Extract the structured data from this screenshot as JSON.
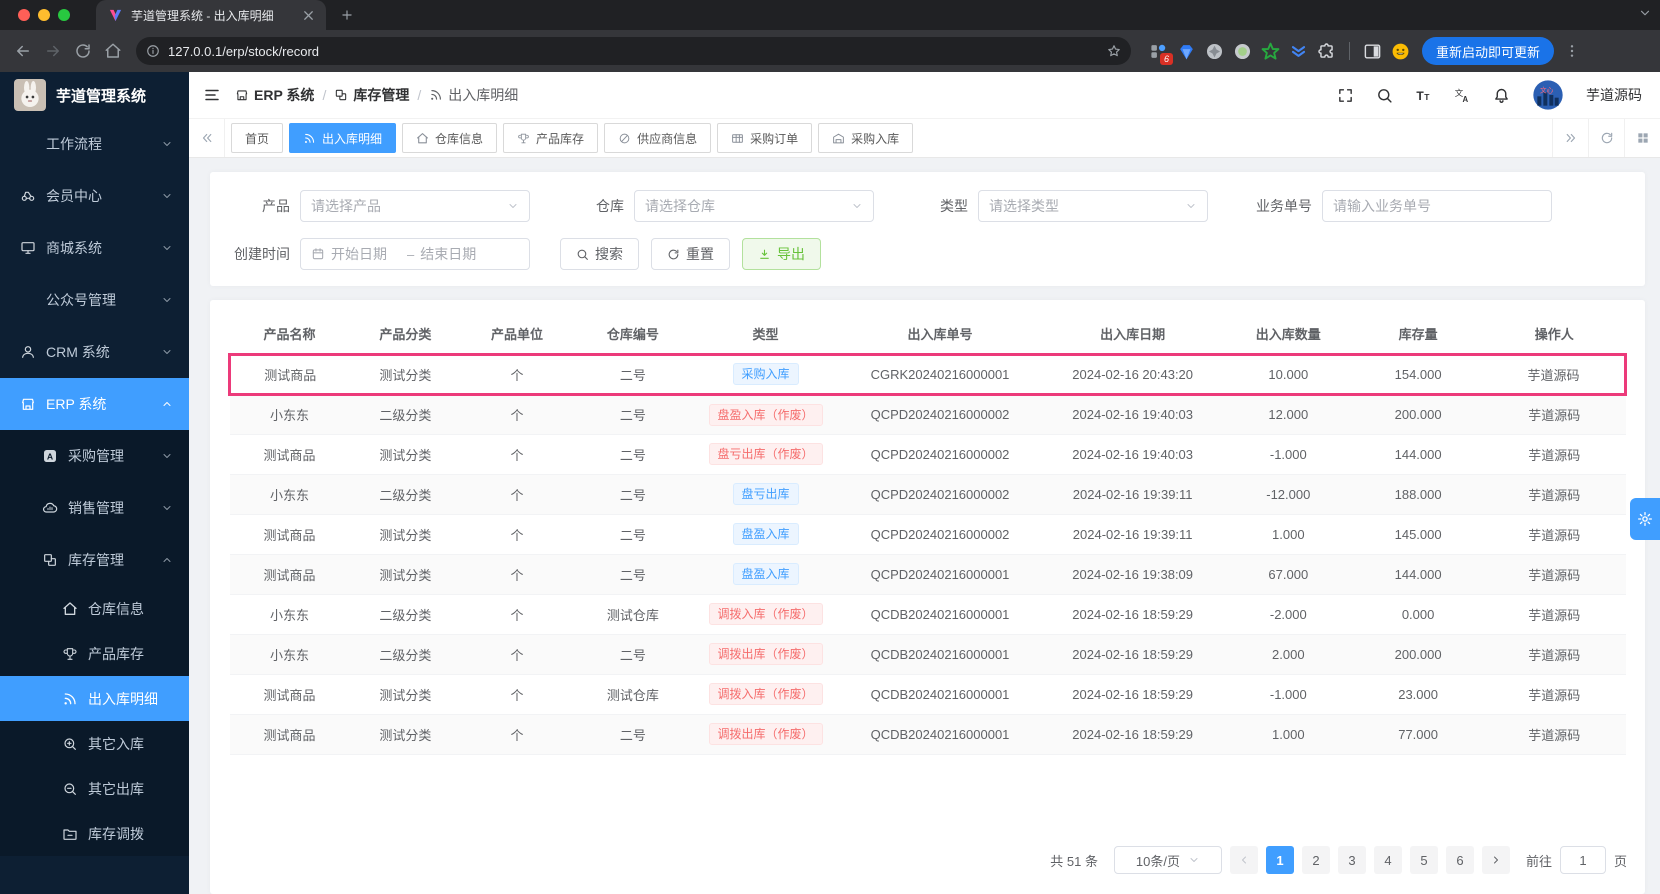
{
  "browser": {
    "tab_title": "芋道管理系统 - 出入库明细",
    "url": "127.0.0.1/erp/stock/record",
    "update_button": "重新启动即可更新",
    "extension_badge": "6"
  },
  "sidebar": {
    "app_title": "芋道管理系统",
    "menu": [
      {
        "label": "工作流程",
        "level": 1,
        "icon": null,
        "chevron": "down",
        "active": false
      },
      {
        "label": "会员中心",
        "level": 1,
        "icon": "member",
        "chevron": "down",
        "active": false
      },
      {
        "label": "商城系统",
        "level": 1,
        "icon": "monitor",
        "chevron": "down",
        "active": false
      },
      {
        "label": "公众号管理",
        "level": 1,
        "icon": null,
        "chevron": "down",
        "active": false
      },
      {
        "label": "CRM 系统",
        "level": 1,
        "icon": "person",
        "chevron": "down",
        "active": false
      },
      {
        "label": "ERP 系统",
        "level": 1,
        "icon": "store",
        "chevron": "up",
        "active": true
      },
      {
        "label": "采购管理",
        "level": 2,
        "icon": "a-square",
        "chevron": "down",
        "active": false
      },
      {
        "label": "销售管理",
        "level": 2,
        "icon": "cloud",
        "chevron": "down",
        "active": false
      },
      {
        "label": "库存管理",
        "level": 2,
        "icon": "boxes",
        "chevron": "up",
        "active": false
      },
      {
        "label": "仓库信息",
        "level": 3,
        "icon": "home",
        "chevron": null,
        "active": false
      },
      {
        "label": "产品库存",
        "level": 3,
        "icon": "cup",
        "chevron": null,
        "active": false
      },
      {
        "label": "出入库明细",
        "level": 3,
        "icon": "signal",
        "chevron": null,
        "active": true
      },
      {
        "label": "其它入库",
        "level": 3,
        "icon": "zoom-in",
        "chevron": null,
        "active": false
      },
      {
        "label": "其它出库",
        "level": 3,
        "icon": "zoom-out",
        "chevron": null,
        "active": false
      },
      {
        "label": "库存调拨",
        "level": 3,
        "icon": "folder",
        "chevron": null,
        "active": false
      }
    ]
  },
  "header": {
    "breadcrumb": [
      {
        "label": "ERP 系统",
        "icon": "store"
      },
      {
        "label": "库存管理",
        "icon": "boxes"
      },
      {
        "label": "出入库明细",
        "icon": "signal"
      }
    ],
    "username": "芋道源码"
  },
  "tabbar": {
    "tabs": [
      {
        "label": "首页",
        "icon": null,
        "active": false
      },
      {
        "label": "出入库明细",
        "icon": "signal",
        "active": true
      },
      {
        "label": "仓库信息",
        "icon": "home",
        "active": false
      },
      {
        "label": "产品库存",
        "icon": "cup",
        "active": false
      },
      {
        "label": "供应商信息",
        "icon": "slash-circle",
        "active": false
      },
      {
        "label": "采购订单",
        "icon": "table",
        "active": false
      },
      {
        "label": "采购入库",
        "icon": "factory",
        "active": false
      }
    ]
  },
  "filters": {
    "product_label": "产品",
    "product_placeholder": "请选择产品",
    "warehouse_label": "仓库",
    "warehouse_placeholder": "请选择仓库",
    "type_label": "类型",
    "type_placeholder": "请选择类型",
    "biz_no_label": "业务单号",
    "biz_no_placeholder": "请输入业务单号",
    "create_time_label": "创建时间",
    "date_start_placeholder": "开始日期",
    "date_separator": "–",
    "date_end_placeholder": "结束日期",
    "search_button": "搜索",
    "reset_button": "重置",
    "export_button": "导出"
  },
  "table": {
    "columns": [
      "产品名称",
      "产品分类",
      "产品单位",
      "仓库编号",
      "类型",
      "出入库单号",
      "出入库日期",
      "出入库数量",
      "库存量",
      "操作人"
    ],
    "rows": [
      {
        "product": "测试商品",
        "category": "测试分类",
        "unit": "个",
        "warehouse": "二号",
        "type": "采购入库",
        "type_color": "blue",
        "no": "CGRK20240216000001",
        "date": "2024-02-16 20:43:20",
        "qty": "10.000",
        "stock": "154.000",
        "operator": "芋道源码",
        "highlighted": true
      },
      {
        "product": "小东东",
        "category": "二级分类",
        "unit": "个",
        "warehouse": "二号",
        "type": "盘盈入库（作废）",
        "type_color": "red",
        "no": "QCPD20240216000002",
        "date": "2024-02-16 19:40:03",
        "qty": "12.000",
        "stock": "200.000",
        "operator": "芋道源码",
        "highlighted": false
      },
      {
        "product": "测试商品",
        "category": "测试分类",
        "unit": "个",
        "warehouse": "二号",
        "type": "盘亏出库（作废）",
        "type_color": "red",
        "no": "QCPD20240216000002",
        "date": "2024-02-16 19:40:03",
        "qty": "-1.000",
        "stock": "144.000",
        "operator": "芋道源码",
        "highlighted": false
      },
      {
        "product": "小东东",
        "category": "二级分类",
        "unit": "个",
        "warehouse": "二号",
        "type": "盘亏出库",
        "type_color": "blue",
        "no": "QCPD20240216000002",
        "date": "2024-02-16 19:39:11",
        "qty": "-12.000",
        "stock": "188.000",
        "operator": "芋道源码",
        "highlighted": false
      },
      {
        "product": "测试商品",
        "category": "测试分类",
        "unit": "个",
        "warehouse": "二号",
        "type": "盘盈入库",
        "type_color": "blue",
        "no": "QCPD20240216000002",
        "date": "2024-02-16 19:39:11",
        "qty": "1.000",
        "stock": "145.000",
        "operator": "芋道源码",
        "highlighted": false
      },
      {
        "product": "测试商品",
        "category": "测试分类",
        "unit": "个",
        "warehouse": "二号",
        "type": "盘盈入库",
        "type_color": "blue",
        "no": "QCPD20240216000001",
        "date": "2024-02-16 19:38:09",
        "qty": "67.000",
        "stock": "144.000",
        "operator": "芋道源码",
        "highlighted": false
      },
      {
        "product": "小东东",
        "category": "二级分类",
        "unit": "个",
        "warehouse": "测试仓库",
        "type": "调拨入库（作废）",
        "type_color": "red",
        "no": "QCDB20240216000001",
        "date": "2024-02-16 18:59:29",
        "qty": "-2.000",
        "stock": "0.000",
        "operator": "芋道源码",
        "highlighted": false
      },
      {
        "product": "小东东",
        "category": "二级分类",
        "unit": "个",
        "warehouse": "二号",
        "type": "调拨出库（作废）",
        "type_color": "red",
        "no": "QCDB20240216000001",
        "date": "2024-02-16 18:59:29",
        "qty": "2.000",
        "stock": "200.000",
        "operator": "芋道源码",
        "highlighted": false
      },
      {
        "product": "测试商品",
        "category": "测试分类",
        "unit": "个",
        "warehouse": "测试仓库",
        "type": "调拨入库（作废）",
        "type_color": "red",
        "no": "QCDB20240216000001",
        "date": "2024-02-16 18:59:29",
        "qty": "-1.000",
        "stock": "23.000",
        "operator": "芋道源码",
        "highlighted": false
      },
      {
        "product": "测试商品",
        "category": "测试分类",
        "unit": "个",
        "warehouse": "二号",
        "type": "调拨出库（作废）",
        "type_color": "red",
        "no": "QCDB20240216000001",
        "date": "2024-02-16 18:59:29",
        "qty": "1.000",
        "stock": "77.000",
        "operator": "芋道源码",
        "highlighted": false
      }
    ]
  },
  "pagination": {
    "total": "共 51 条",
    "page_size": "10条/页",
    "pages": [
      "1",
      "2",
      "3",
      "4",
      "5",
      "6"
    ],
    "active_page": "1",
    "goto_label": "前往",
    "goto_value": "1",
    "page_unit": "页"
  },
  "colors": {
    "accent": "#409eff",
    "badge_blue_text": "#409eff",
    "badge_blue_bg": "#ecf5ff",
    "badge_red_text": "#f56c6c",
    "badge_red_bg": "#fef0f0",
    "highlight_pink": "#ec3a7a",
    "export_green": "#67c23a",
    "sidebar_bg": "#0d1f33"
  }
}
